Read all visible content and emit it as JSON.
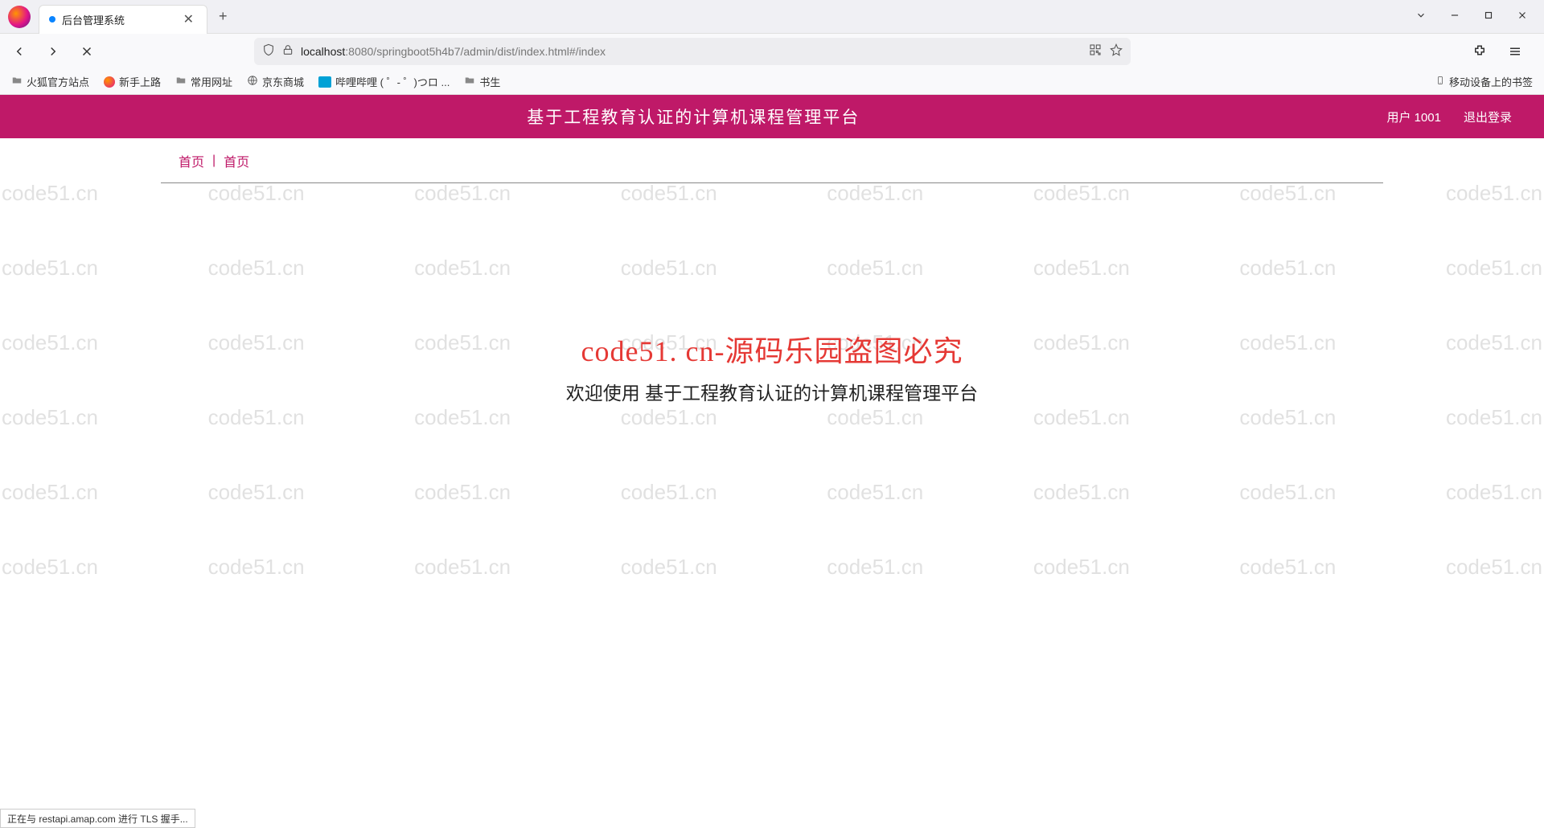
{
  "browser": {
    "tab_title": "后台管理系统",
    "url_host": "localhost",
    "url_path": ":8080/springboot5h4b7/admin/dist/index.html#/index"
  },
  "bookmarks": {
    "items": [
      "火狐官方站点",
      "新手上路",
      "常用网址",
      "京东商城",
      "哔哩哔哩 (  ゜- ゜)つロ ...",
      "书生"
    ],
    "mobile": "移动设备上的书签"
  },
  "watermark": "code51.cn",
  "app": {
    "title": "基于工程教育认证的计算机课程管理平台",
    "user_label": "用户 1001",
    "logout": "退出登录"
  },
  "breadcrumb": {
    "home": "首页",
    "current": "首页"
  },
  "welcome": {
    "headline": "code51. cn-源码乐园盗图必究",
    "subtitle": "欢迎使用 基于工程教育认证的计算机课程管理平台"
  },
  "status": "正在与 restapi.amap.com 进行 TLS 握手..."
}
